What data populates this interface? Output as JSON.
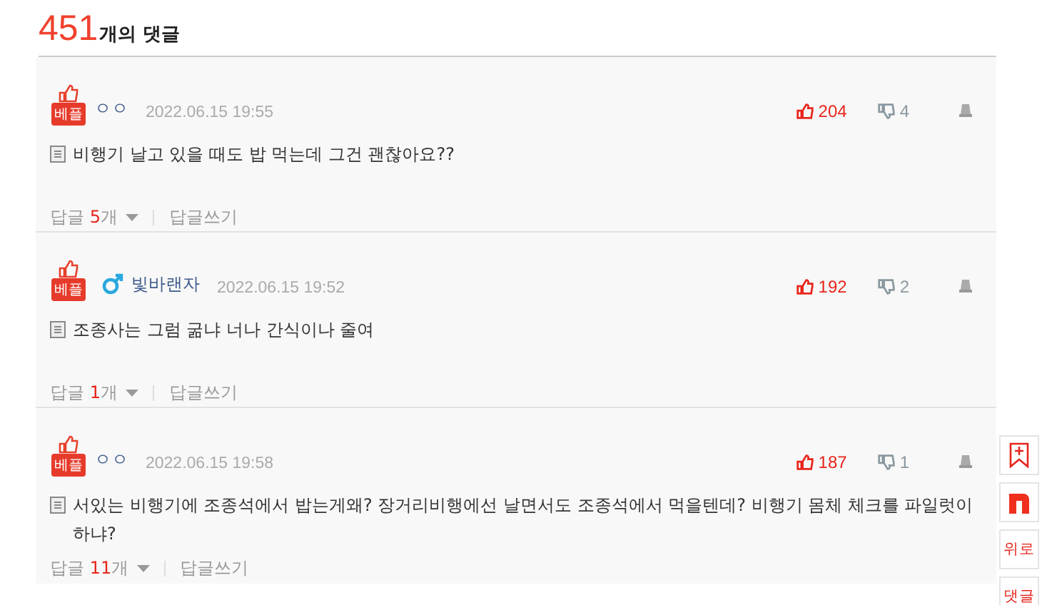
{
  "header": {
    "count": "451",
    "label": "개의 댓글"
  },
  "comments": [
    {
      "badge": "베플",
      "gender_icon": false,
      "username": "ㅇㅇ",
      "date": "2022.06.15 19:55",
      "text": "비행기 날고 있을 때도 밥 먹는데 그건 괜찮아요??",
      "likes": "204",
      "dislikes": "4",
      "reply_label": "답글",
      "reply_count": "5",
      "reply_unit": "개",
      "write_label": "답글쓰기"
    },
    {
      "badge": "베플",
      "gender_icon": true,
      "username": "빛바랜자",
      "date": "2022.06.15 19:52",
      "text": "조종사는 그럼 굶냐 너나 간식이나 줄여",
      "likes": "192",
      "dislikes": "2",
      "reply_label": "답글",
      "reply_count": "1",
      "reply_unit": "개",
      "write_label": "답글쓰기"
    },
    {
      "badge": "베플",
      "gender_icon": false,
      "username": "ㅇㅇ",
      "date": "2022.06.15 19:58",
      "text": "서있는 비행기에 조종석에서 밥는게왜? 장거리비행에선 날면서도 조종석에서 먹을텐데? 비행기 몸체 체크를 파일럿이 하냐?",
      "likes": "187",
      "dislikes": "1",
      "reply_label": "답글",
      "reply_count": "11",
      "reply_unit": "개",
      "write_label": "답글쓰기"
    }
  ],
  "side_buttons": [
    {
      "kind": "bookmark"
    },
    {
      "kind": "logo"
    },
    {
      "kind": "text",
      "label": "위로"
    },
    {
      "kind": "text",
      "label": "댓글"
    }
  ]
}
